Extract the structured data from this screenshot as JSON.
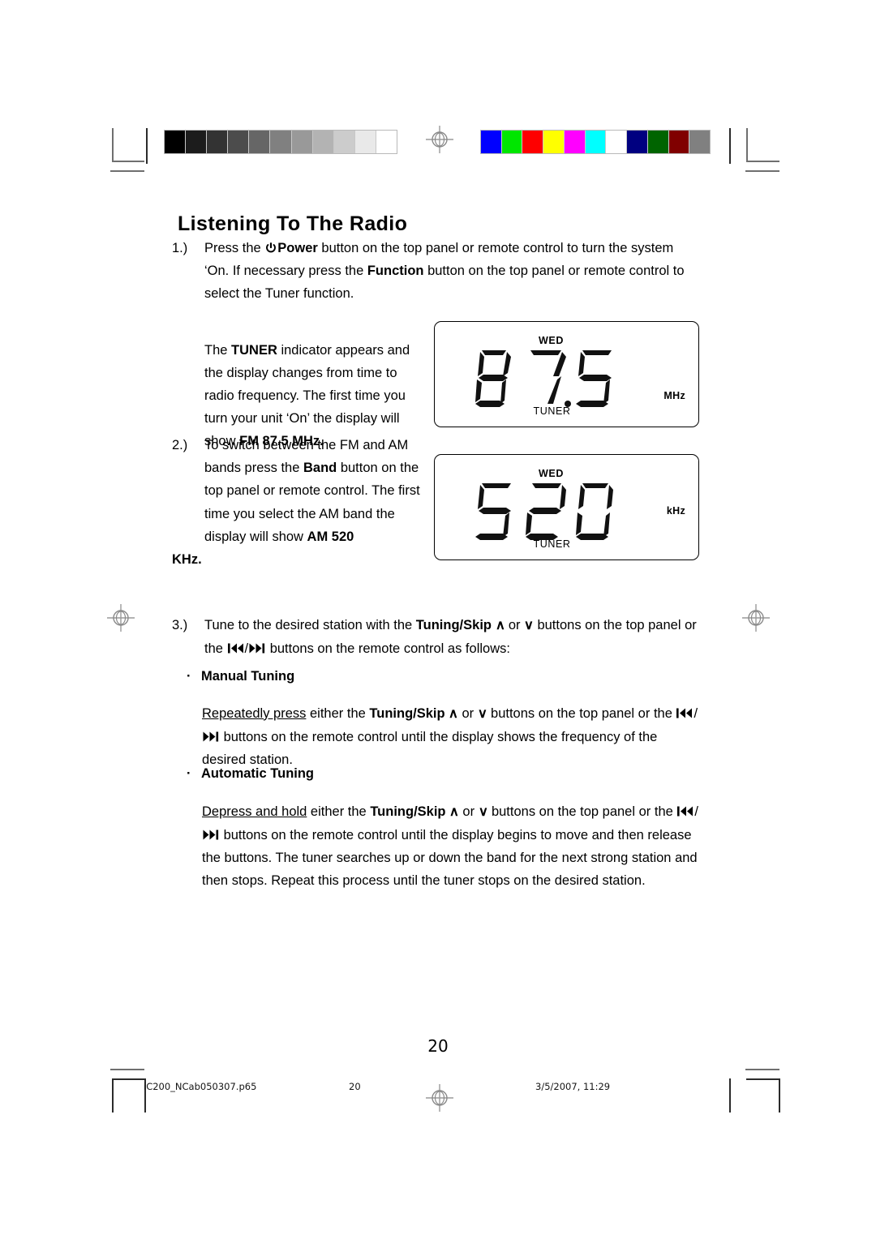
{
  "document": {
    "page_title": "Listening To The Radio",
    "page_number": "20"
  },
  "calibration": {
    "gray_ramp": [
      "#000000",
      "#1c1c1c",
      "#333333",
      "#4c4c4c",
      "#666666",
      "#808080",
      "#999999",
      "#b3b3b3",
      "#cccccc",
      "#e9e9e9",
      "#ffffff"
    ],
    "color_ramp": [
      "#0000ff",
      "#00e600",
      "#fe0000",
      "#ffff00",
      "#ff00ff",
      "#00ffff",
      "#ffffff",
      "#000080",
      "#006400",
      "#800000",
      "#808080"
    ]
  },
  "steps": {
    "step1": {
      "number": "1.)",
      "text_a": "Press the ",
      "power_label": "Power",
      "text_b": " button on the top panel or remote control to turn the system ‘On. If necessary press the ",
      "function_label": "Function",
      "text_c": " button on the top panel or remote control to select the Tuner function."
    },
    "tuner_para": {
      "text_a": "The ",
      "tuner_label": "TUNER",
      "text_b": " indicator appears and the display changes from time to radio frequency. The first time you turn your unit ‘On’ the display will show ",
      "freq_label": "FM 87.5 MHz."
    },
    "step2": {
      "number": "2.)",
      "text_a": "To switch between the FM and AM bands press the ",
      "band_label": "Band",
      "text_b": " button on the top panel or remote control. The first time you select the AM band the display will show ",
      "am_label": "AM 520",
      "text_c": " ",
      "am_label2": "KHz."
    },
    "step3": {
      "number": "3.)",
      "text_a": "Tune to the desired station with the ",
      "tuning_skip_label": "Tuning/Skip",
      "text_b": " or ",
      "text_c": " buttons on the top panel or the ",
      "text_d": " buttons on the remote control as follows:"
    }
  },
  "bullets": {
    "manual": {
      "marker": "·",
      "label": "Manual Tuning",
      "para": {
        "underlined": "Repeatedly press",
        "text_a": " either the ",
        "tuning_skip_label": "Tuning/Skip",
        "text_b": " or ",
        "text_c": " buttons on the top panel or the ",
        "text_d": " buttons on the remote control until the display shows the frequency of the desired station."
      }
    },
    "automatic": {
      "marker": "·",
      "label": "Automatic Tuning",
      "para": {
        "underlined": "Depress and hold",
        "text_a": " either the ",
        "tuning_skip_label": "Tuning/Skip",
        "text_b": " or ",
        "text_c": " buttons on the top panel or the ",
        "text_d": " buttons on the remote control until the display begins to move and then release the buttons. The tuner searches up or down the band for the next strong station and then stops. Repeat this process until the tuner stops on the desired station."
      }
    }
  },
  "glyphs": {
    "chevron_up": "∧",
    "chevron_down": "∨",
    "slash": "/"
  },
  "lcd_displays": [
    {
      "day_indicator": "WED",
      "digits": "87.5",
      "unit": "MHz",
      "mode_indicator": "TUNER"
    },
    {
      "day_indicator": "WED",
      "digits": "520",
      "unit": "kHz",
      "mode_indicator": "TUNER"
    }
  ],
  "footer": {
    "file_name": "iC200_NCab050307.p65",
    "page": "20",
    "timestamp": "3/5/2007, 11:29"
  }
}
